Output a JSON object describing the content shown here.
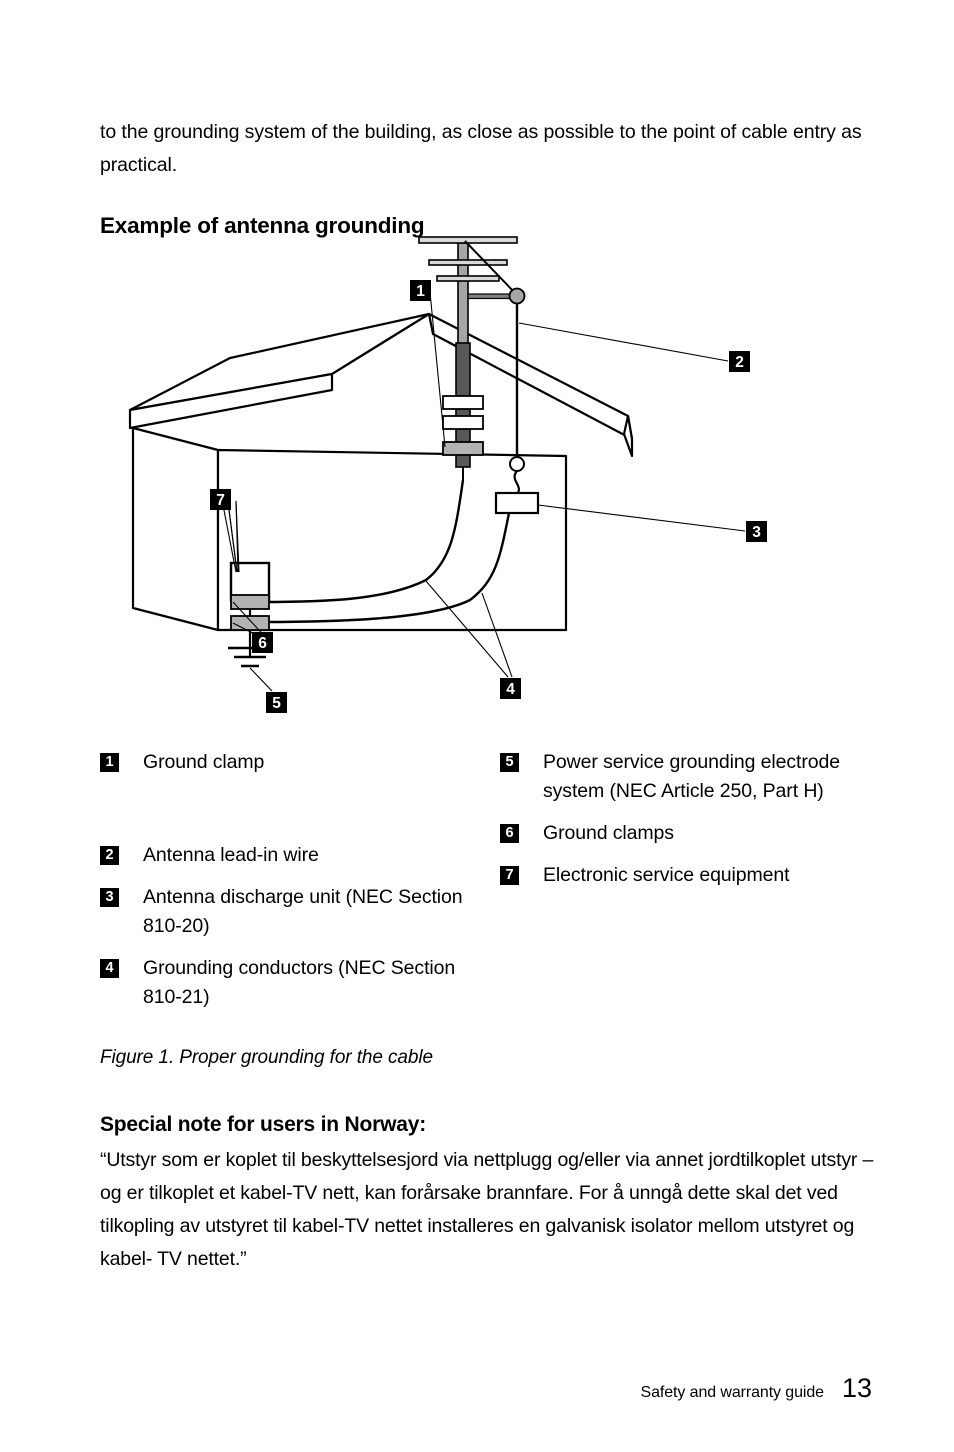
{
  "page": {
    "intro_paragraph": "to the grounding system of the building, as close as possible to the point of cable entry as practical.",
    "section_heading": "Example of antenna grounding",
    "figure_caption": "Figure 1. Proper grounding for the cable",
    "note_heading": "Special note for users in Norway:",
    "note_paragraph": "“Utstyr som er koplet til beskyttelsesjord via nettplugg og/eller via annet jordtilkoplet utstyr – og er tilkoplet et kabel-TV nett, kan forårsake brannfare. For å unngå dette skal det ved tilkopling av utstyret til kabel-TV nettet installeres en galvanisk isolator mellom utstyret og kabel- TV nettet.”"
  },
  "footer": {
    "guide_label": "Safety and warranty guide",
    "page_number": "13"
  },
  "legend": {
    "left_column": [
      {
        "number": "1",
        "label": "Ground clamp"
      },
      {
        "number": "2",
        "label": "Antenna lead-in wire"
      },
      {
        "number": "3",
        "label": "Antenna discharge unit (NEC Section 810-20)"
      },
      {
        "number": "4",
        "label": "Grounding conductors (NEC Section 810-21)"
      }
    ],
    "right_column": [
      {
        "number": "5",
        "label": "Power service grounding electrode system (NEC Article 250, Part H)"
      },
      {
        "number": "6",
        "label": "Ground clamps"
      },
      {
        "number": "7",
        "label": "Electronic service equipment"
      }
    ]
  },
  "figure": {
    "callouts": [
      {
        "number": "1",
        "target": "ground-clamp-on-mast"
      },
      {
        "number": "2",
        "target": "antenna-lead-in-wire"
      },
      {
        "number": "3",
        "target": "antenna-discharge-unit"
      },
      {
        "number": "4",
        "target": "grounding-conductors"
      },
      {
        "number": "5",
        "target": "power-service-grounding-electrode"
      },
      {
        "number": "6",
        "target": "ground-clamps"
      },
      {
        "number": "7",
        "target": "electronic-service-equipment"
      }
    ],
    "colors": {
      "outline": "#000000",
      "mast_light": "#a6a6a6",
      "mast_dark": "#595959",
      "clamp_gray": "#b3b3b3",
      "badge_bg": "#000000",
      "badge_fg": "#ffffff"
    }
  }
}
